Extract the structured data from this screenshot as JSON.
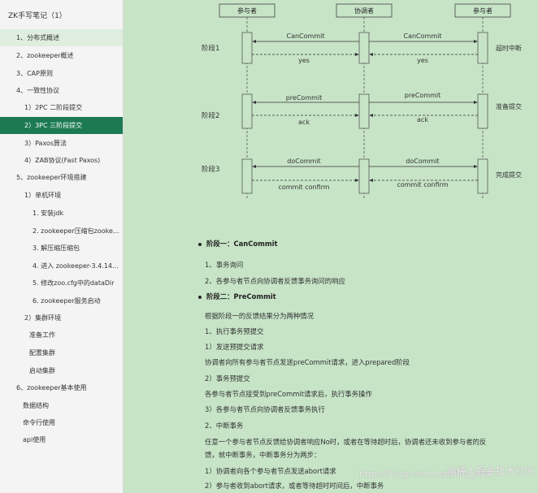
{
  "sidebar": {
    "title": "ZK手写笔记（1）",
    "items": [
      "1、分布式概述",
      "2、zookeeper概述",
      "3、CAP原则",
      "4、一致性协议",
      "1）2PC 二阶段提交",
      "2）3PC 三阶段提交",
      "3）Paxos算法",
      "4）ZAB协议(Fast Paxos)",
      "5、zookeeper环境搭建",
      "1）单机环境",
      "1. 安装jdk",
      "2. zookeeper压缩包zookeep...",
      "3. 解压缩压缩包",
      "4. 进入 zookeeper-3.4.14...",
      "5. 修改zoo.cfg中的dataDir",
      "6. zookeeper服务启动",
      "2）集群环境",
      "准备工作",
      "配置集群",
      "启动集群",
      "6、zookeeper基本使用",
      "数据结构",
      "命令行使用",
      "api使用"
    ]
  },
  "diagram": {
    "actors": [
      "参与者",
      "协调者",
      "参与者"
    ],
    "phases": [
      {
        "label": "阶段1",
        "request": "CanCommit",
        "response": "yes",
        "note": "超时中断"
      },
      {
        "label": "阶段2",
        "request": "preCommit",
        "response": "ack",
        "note": "准备提交"
      },
      {
        "label": "阶段3",
        "request": "doCommit",
        "response": "commit confirm",
        "note": "完成提交"
      }
    ]
  },
  "article": {
    "h1": "阶段一：CanCommit",
    "p1": "1、事务询问",
    "p2": "2、各参与者节点向协调者反馈事务询问的响应",
    "h2": "阶段二：PreCommit",
    "p3": "根据阶段一的反馈结果分为两种情况",
    "p4": "1、执行事务预提交",
    "p5": "1）发送预提交请求",
    "p6": "协调者向所有参与者节点发送preCommit请求，进入prepared阶段",
    "p7": "2）事务预提交",
    "p8": "各参与者节点接受到preCommit请求后，执行事务操作",
    "p9": "3）各参与者节点向协调者反馈事务执行",
    "p10": "2、中断事务",
    "p11": "任意一个参与者节点反馈给协调者响应No时，或者在等待超时后，协调者还未收到参与者的反",
    "p12": "馈，就中断事务，中断事务分为两步：",
    "p13": "1）协调者向各个参与者节点发送abort请求",
    "p14": "2）参与者收到abort请求，或者等待超时时间后，中断事务"
  },
  "watermark": {
    "left": "https://blog.csdn.net/Hilly_java",
    "right": "@稀土掘金技术社区"
  }
}
